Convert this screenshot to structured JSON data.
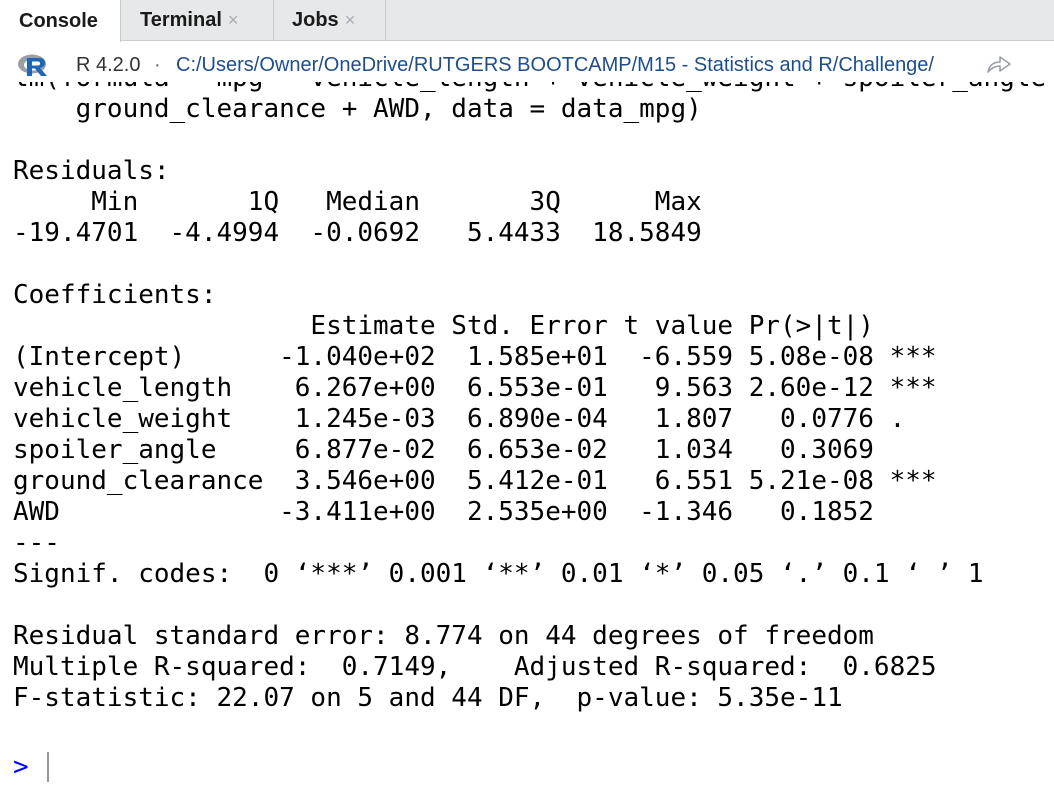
{
  "tabs": [
    {
      "label": "Console",
      "closable": false,
      "active": true
    },
    {
      "label": "Terminal",
      "closable": true,
      "active": false
    },
    {
      "label": "Jobs",
      "closable": true,
      "active": false
    }
  ],
  "tab_close_glyph": "×",
  "pathbar": {
    "r_version": "R 4.2.0",
    "separator": "·",
    "path": "C:/Users/Owner/OneDrive/RUTGERS BOOTCAMP/M15 - Statistics and R/Challenge/",
    "logo_icon": "r-logo-icon",
    "goto_icon": "go-to-directory-icon"
  },
  "console": {
    "cutoff_line": "lm(formula = mpg ~ vehicle_length + vehicle_weight + spoiler_angle +",
    "output": "    ground_clearance + AWD, data = data_mpg)\n\nResiduals:\n     Min       1Q   Median       3Q      Max \n-19.4701  -4.4994  -0.0692   5.4433  18.5849 \n\nCoefficients:\n                   Estimate Std. Error t value Pr(>|t|)    \n(Intercept)      -1.040e+02  1.585e+01  -6.559 5.08e-08 ***\nvehicle_length    6.267e+00  6.553e-01   9.563 2.60e-12 ***\nvehicle_weight    1.245e-03  6.890e-04   1.807   0.0776 .  \nspoiler_angle     6.877e-02  6.653e-02   1.034   0.3069    \nground_clearance  3.546e+00  5.412e-01   6.551 5.21e-08 ***\nAWD              -3.411e+00  2.535e+00  -1.346   0.1852    \n---\nSignif. codes:  0 ‘***’ 0.001 ‘**’ 0.01 ‘*’ 0.05 ‘.’ 0.1 ‘ ’ 1\n\nResidual standard error: 8.774 on 44 degrees of freedom\nMultiple R-squared:  0.7149,\tAdjusted R-squared:  0.6825 \nF-statistic: 22.07 on 5 and 44 DF,  p-value: 5.35e-11",
    "prompt": ">"
  },
  "colors": {
    "prompt": "#0000ff",
    "path_link": "#1f4e8c",
    "r_logo_blue": "#2165b6",
    "r_logo_gray": "#9aa0a6"
  }
}
